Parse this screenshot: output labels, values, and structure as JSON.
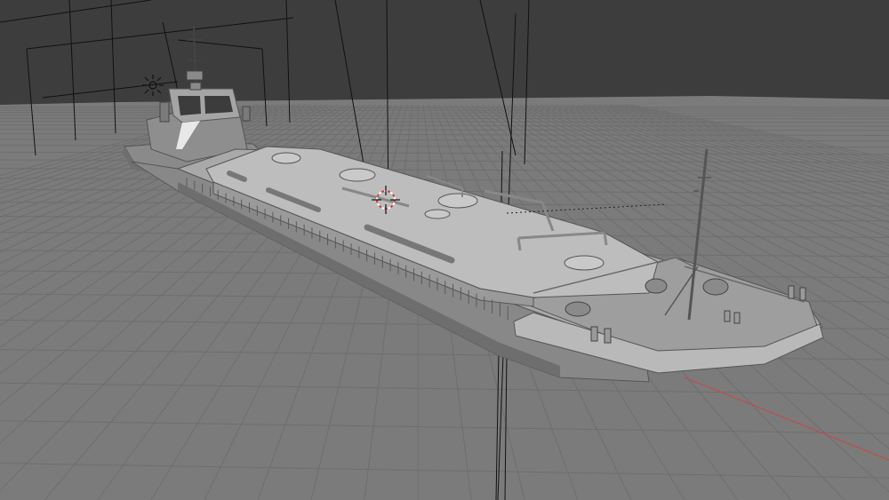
{
  "viewport": {
    "mode": "3D Viewport",
    "shading": "solid",
    "background_color": "#3d3d3d",
    "floor_color": "#7a7a7a",
    "grid_color": "#6e6e6e",
    "x_axis_color": "#c44a4a",
    "hull_color": "#9a9a9a",
    "deck_color": "#b4b4b4",
    "tank_color": "#bdbdbd",
    "camera_frame_color": "#111111"
  },
  "scene_objects": [
    {
      "name": "tugboat",
      "icon": "ship-icon"
    },
    {
      "name": "tank-barge",
      "icon": "barge-icon"
    }
  ],
  "gizmos": {
    "origin": "3d-cursor-icon",
    "light": "sun-light-icon"
  }
}
